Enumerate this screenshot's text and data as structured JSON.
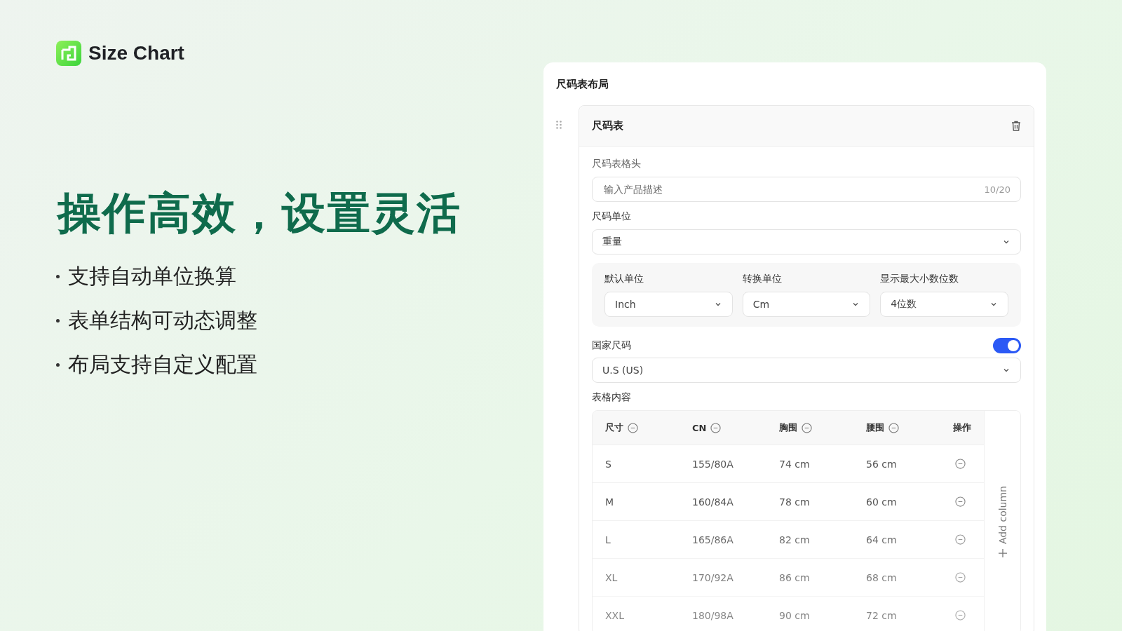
{
  "brand": {
    "name": "Size Chart"
  },
  "headline": "操作高效，设置灵活",
  "features": [
    "支持自动单位换算",
    "表单结构可动态调整",
    "布局支持自定义配置"
  ],
  "panel": {
    "title": "尺码表布局",
    "section": {
      "title": "尺码表",
      "header_field": {
        "label": "尺码表格头",
        "placeholder": "输入产品描述",
        "counter": "10/20"
      },
      "unit_field": {
        "label": "尺码单位",
        "value": "重量"
      },
      "unit_options": [
        {
          "label": "默认单位",
          "value": "Inch"
        },
        {
          "label": "转换单位",
          "value": "Cm"
        },
        {
          "label": "显示最大小数位数",
          "value": "4位数"
        }
      ],
      "country_field": {
        "label": "国家尺码",
        "on": true,
        "value": "U.S (US)"
      },
      "table": {
        "label": "表格内容",
        "add_column": "Add column",
        "columns": [
          {
            "label": "尺寸",
            "removable": true
          },
          {
            "label": "CN",
            "removable": true
          },
          {
            "label": "胸围",
            "removable": true
          },
          {
            "label": "腰围",
            "removable": true
          },
          {
            "label": "操作",
            "removable": false
          }
        ],
        "rows": [
          [
            "S",
            "155/80A",
            "74 cm",
            "56 cm"
          ],
          [
            "M",
            "160/84A",
            "78 cm",
            "60 cm"
          ],
          [
            "L",
            "165/86A",
            "82 cm",
            "64 cm"
          ],
          [
            "XL",
            "170/92A",
            "86 cm",
            "68 cm"
          ],
          [
            "XXL",
            "180/98A",
            "90 cm",
            "72 cm"
          ]
        ]
      }
    }
  }
}
